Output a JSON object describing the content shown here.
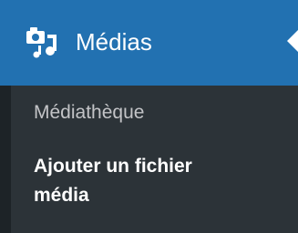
{
  "menu": {
    "title": "Médias",
    "icon": "media-icon",
    "colors": {
      "header_bg": "#2271b1",
      "submenu_bg": "#2c3338",
      "strip_bg": "#1d2327",
      "inactive_text": "#c3c4c7",
      "active_text": "#ffffff"
    },
    "items": [
      {
        "label": "Médiathèque",
        "current": false
      },
      {
        "label": "Ajouter un fichier média",
        "current": true
      }
    ]
  }
}
